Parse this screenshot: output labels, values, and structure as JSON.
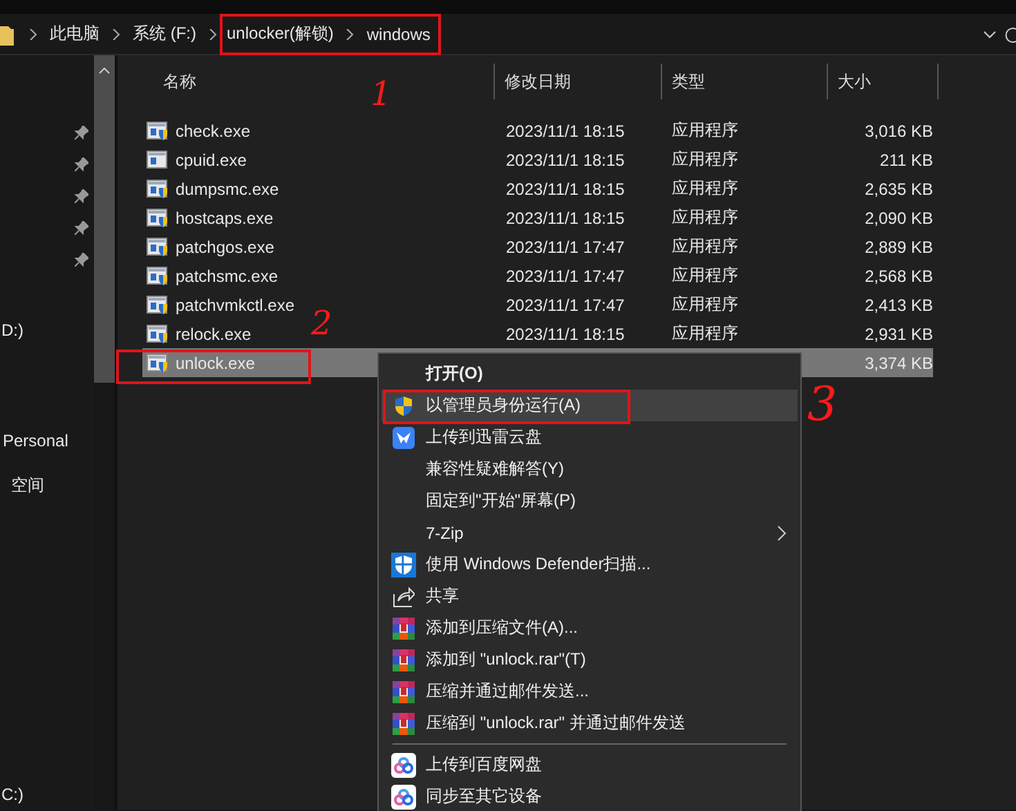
{
  "address_bar": {
    "crumbs": [
      "此电脑",
      "系统 (F:)"
    ],
    "highlighted_crumbs": [
      "unlocker(解锁)",
      "windows"
    ],
    "note": "1"
  },
  "nav_pane": {
    "pinned_items": [
      {
        "pinned": true
      },
      {
        "pinned": true
      },
      {
        "pinned": true
      },
      {
        "pinned": true
      },
      {
        "pinned": true
      }
    ],
    "items": [
      {
        "label": "D:)"
      },
      {
        "label": "Personal"
      },
      {
        "label": "空间"
      },
      {
        "label": "C:)"
      }
    ]
  },
  "columns": [
    {
      "label": "名称"
    },
    {
      "label": "修改日期"
    },
    {
      "label": "类型"
    },
    {
      "label": "大小"
    }
  ],
  "files": [
    {
      "name": "check.exe",
      "modified": "2023/11/1 18:15",
      "type": "应用程序",
      "size": "3,016 KB",
      "uac": true,
      "selected": false
    },
    {
      "name": "cpuid.exe",
      "modified": "2023/11/1 18:15",
      "type": "应用程序",
      "size": "211 KB",
      "uac": false,
      "selected": false
    },
    {
      "name": "dumpsmc.exe",
      "modified": "2023/11/1 18:15",
      "type": "应用程序",
      "size": "2,635 KB",
      "uac": true,
      "selected": false
    },
    {
      "name": "hostcaps.exe",
      "modified": "2023/11/1 18:15",
      "type": "应用程序",
      "size": "2,090 KB",
      "uac": true,
      "selected": false
    },
    {
      "name": "patchgos.exe",
      "modified": "2023/11/1 17:47",
      "type": "应用程序",
      "size": "2,889 KB",
      "uac": true,
      "selected": false
    },
    {
      "name": "patchsmc.exe",
      "modified": "2023/11/1 17:47",
      "type": "应用程序",
      "size": "2,568 KB",
      "uac": true,
      "selected": false
    },
    {
      "name": "patchvmkctl.exe",
      "modified": "2023/11/1 17:47",
      "type": "应用程序",
      "size": "2,413 KB",
      "uac": true,
      "selected": false
    },
    {
      "name": "relock.exe",
      "modified": "2023/11/1 18:15",
      "type": "应用程序",
      "size": "2,931 KB",
      "uac": true,
      "selected": false
    },
    {
      "name": "unlock.exe",
      "size": "3,374 KB",
      "uac": true,
      "selected": true,
      "note": "2"
    }
  ],
  "context_menu": {
    "items": [
      {
        "kind": "plain",
        "label": "打开(O)",
        "bold": true,
        "hovered": false,
        "submenu": false
      },
      {
        "kind": "uac",
        "label": "以管理员身份运行(A)",
        "bold": false,
        "hovered": true,
        "submenu": false,
        "note": "3"
      },
      {
        "kind": "bird",
        "label": "上传到迅雷云盘",
        "bold": false,
        "hovered": false,
        "submenu": false
      },
      {
        "kind": "plain",
        "label": "兼容性疑难解答(Y)",
        "bold": false,
        "hovered": false,
        "submenu": false
      },
      {
        "kind": "plain",
        "label": "固定到\"开始\"屏幕(P)",
        "bold": false,
        "hovered": false,
        "submenu": false
      },
      {
        "kind": "plain",
        "label": "7-Zip",
        "bold": false,
        "hovered": false,
        "submenu": true
      },
      {
        "kind": "defender",
        "label": "使用 Windows Defender扫描...",
        "bold": false,
        "hovered": false,
        "submenu": false
      },
      {
        "kind": "share",
        "label": "共享",
        "bold": false,
        "hovered": false,
        "submenu": false
      },
      {
        "kind": "archive",
        "label": "添加到压缩文件(A)...",
        "bold": false,
        "hovered": false,
        "submenu": false
      },
      {
        "kind": "archive",
        "label": "添加到 \"unlock.rar\"(T)",
        "bold": false,
        "hovered": false,
        "submenu": false
      },
      {
        "kind": "archive",
        "label": "压缩并通过邮件发送...",
        "bold": false,
        "hovered": false,
        "submenu": false
      },
      {
        "kind": "archive",
        "label": "压缩到 \"unlock.rar\" 并通过邮件发送",
        "bold": false,
        "hovered": false,
        "submenu": false
      },
      {
        "kind": "separator"
      },
      {
        "kind": "cloud",
        "label": "上传到百度网盘",
        "bold": false,
        "hovered": false,
        "submenu": false
      },
      {
        "kind": "cloud",
        "label": "同步至其它设备",
        "bold": false,
        "hovered": false,
        "submenu": false
      }
    ]
  }
}
